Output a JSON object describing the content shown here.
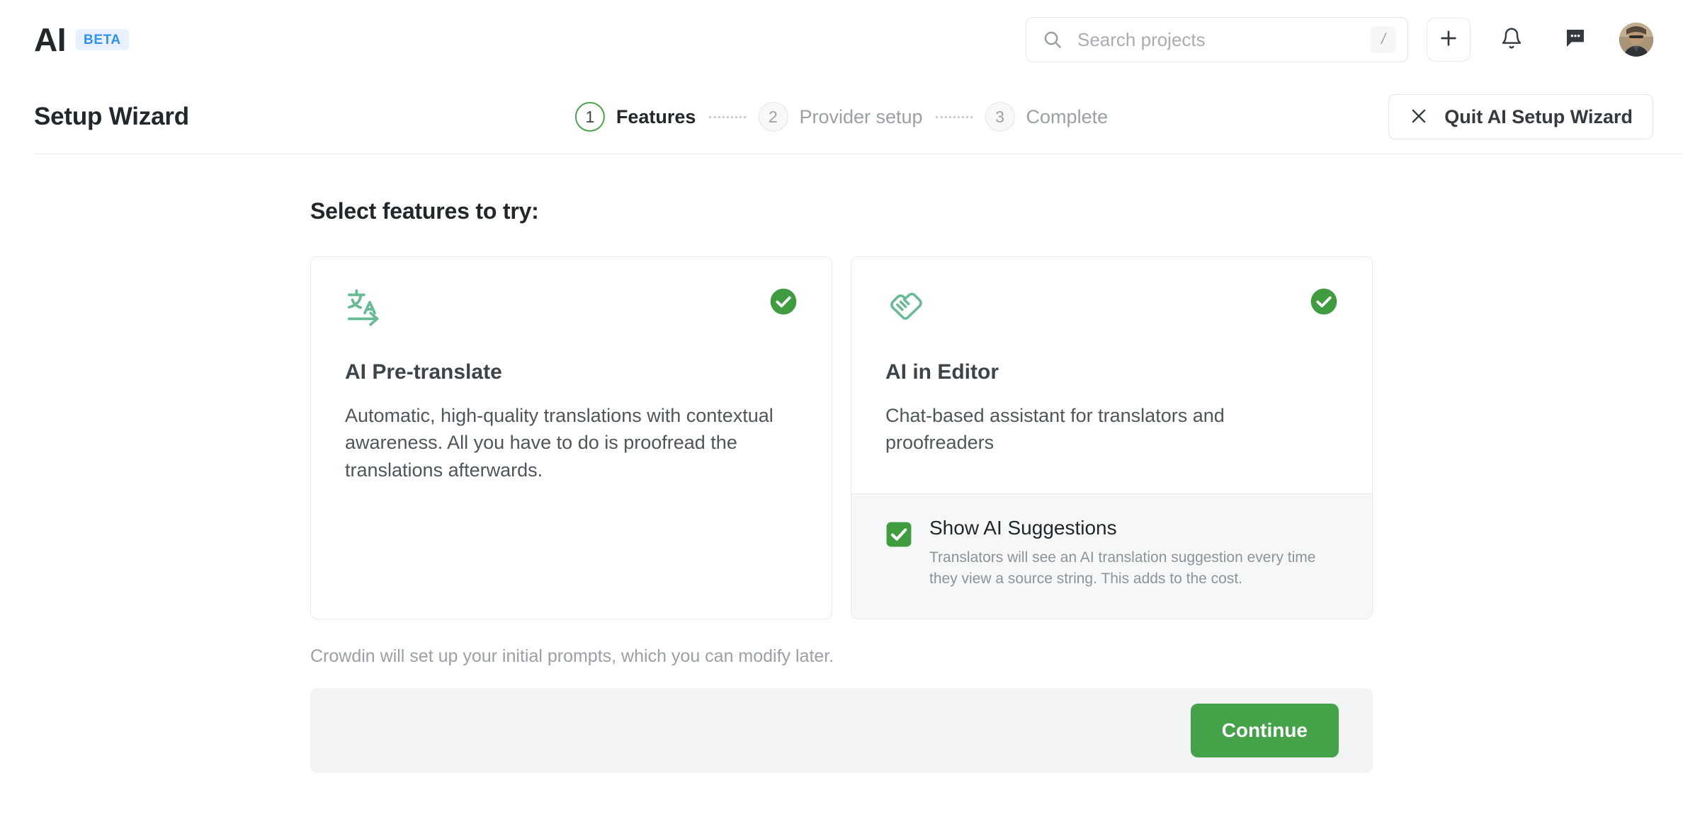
{
  "topbar": {
    "brand_mark": "AI",
    "brand_badge": "BETA",
    "search": {
      "placeholder": "Search projects",
      "shortcut": "/",
      "icon": "search-icon"
    },
    "actions": [
      {
        "name": "add-button",
        "icon": "plus-icon"
      },
      {
        "name": "notifications-button",
        "icon": "bell-icon"
      },
      {
        "name": "messages-button",
        "icon": "chat-bubble-icon"
      },
      {
        "name": "user-menu",
        "icon": "avatar"
      }
    ]
  },
  "wizard": {
    "title": "Setup Wizard",
    "steps": [
      {
        "number": "1",
        "label": "Features",
        "state": "active"
      },
      {
        "number": "2",
        "label": "Provider setup",
        "state": "inactive"
      },
      {
        "number": "3",
        "label": "Complete",
        "state": "inactive"
      }
    ],
    "quit_label": "Quit AI Setup Wizard",
    "quit_icon": "close-icon"
  },
  "main": {
    "section_title": "Select features to try:",
    "cards": [
      {
        "icon": "translate-icon",
        "title": "AI Pre-translate",
        "description": "Automatic, high-quality translations with contextual awareness. All you have to do is proofread the translations afterwards.",
        "selected": true,
        "selected_icon": "check-circle-icon"
      },
      {
        "icon": "handshake-icon",
        "title": "AI in Editor",
        "description": "Chat-based assistant for translators and proofreaders",
        "selected": true,
        "selected_icon": "check-circle-icon",
        "option": {
          "checked": true,
          "label": "Show AI Suggestions",
          "description": "Translators will see an AI translation suggestion every time they view a source string. This adds to the cost."
        }
      }
    ],
    "note": "Crowdin will set up your initial prompts, which you can modify later.",
    "continue_label": "Continue"
  },
  "colors": {
    "accent_green": "#44a248",
    "icon_green": "#67bb93",
    "badge_blue": "#2e90f5",
    "text_dark": "#22272b",
    "text_muted": "#9aa0a6"
  }
}
